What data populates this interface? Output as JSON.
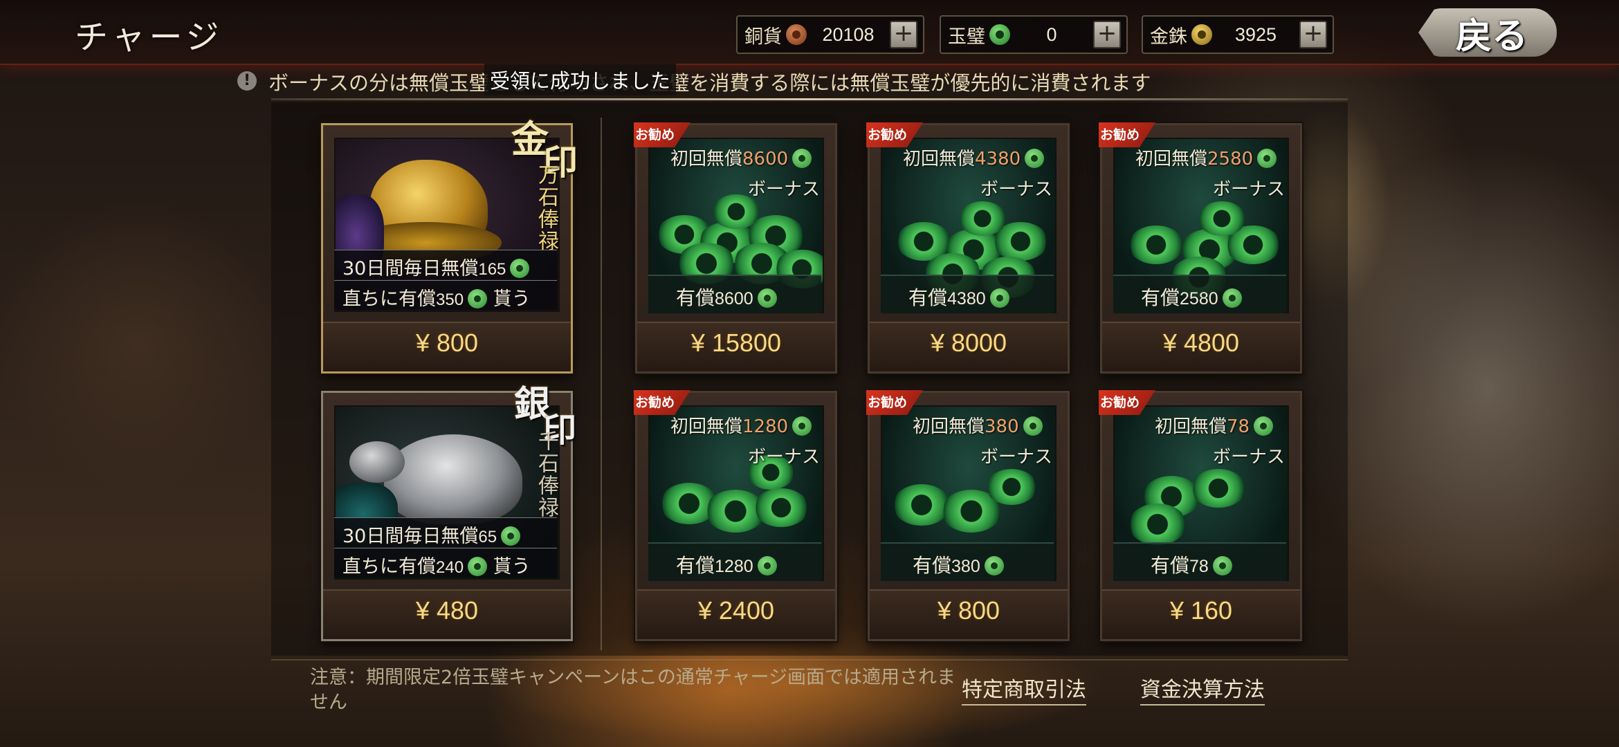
{
  "header": {
    "title": "チャージ",
    "currencies": [
      {
        "name": "銅貨",
        "icon": "copper-coin-icon",
        "value": "20108",
        "plus": "+"
      },
      {
        "name": "玉璧",
        "icon": "jade-coin-icon",
        "value": "0",
        "plus": "+"
      },
      {
        "name": "金銖",
        "icon": "gold-coin-icon",
        "value": "3925",
        "plus": "+"
      }
    ],
    "back_label": "戻る"
  },
  "notice": {
    "icon": "!",
    "text": "ボーナスの分は無償玉璧として付与され、玉璧を消費する際には無償玉璧が優先的に消費されます"
  },
  "toast": "受領に成功しました",
  "seals": [
    {
      "title_1": "金",
      "title_2": "印",
      "subtitle": "万石俸禄",
      "daily": {
        "prefix": "30日間毎日無償",
        "amount": "165"
      },
      "instant": {
        "prefix": "直ちに有償",
        "amount": "350",
        "suffix": "貰う"
      },
      "price": "¥ 800"
    },
    {
      "title_1": "銀",
      "title_2": "印",
      "subtitle": "千石俸禄",
      "daily": {
        "prefix": "30日間毎日無償",
        "amount": "65"
      },
      "instant": {
        "prefix": "直ちに有償",
        "amount": "240",
        "suffix": "貰う"
      },
      "price": "¥ 480"
    }
  ],
  "packs": [
    {
      "badge": "お勧め",
      "bonus_prefix": "初回無償",
      "bonus_amount": "8600",
      "bonus_word": "ボーナス",
      "paid_prefix": "有償",
      "paid_amount": "8600",
      "price": "¥ 15800"
    },
    {
      "badge": "お勧め",
      "bonus_prefix": "初回無償",
      "bonus_amount": "4380",
      "bonus_word": "ボーナス",
      "paid_prefix": "有償",
      "paid_amount": "4380",
      "price": "¥ 8000"
    },
    {
      "badge": "お勧め",
      "bonus_prefix": "初回無償",
      "bonus_amount": "2580",
      "bonus_word": "ボーナス",
      "paid_prefix": "有償",
      "paid_amount": "2580",
      "price": "¥ 4800"
    },
    {
      "badge": "お勧め",
      "bonus_prefix": "初回無償",
      "bonus_amount": "1280",
      "bonus_word": "ボーナス",
      "paid_prefix": "有償",
      "paid_amount": "1280",
      "price": "¥ 2400"
    },
    {
      "badge": "お勧め",
      "bonus_prefix": "初回無償",
      "bonus_amount": "380",
      "bonus_word": "ボーナス",
      "paid_prefix": "有償",
      "paid_amount": "380",
      "price": "¥ 800"
    },
    {
      "badge": "お勧め",
      "bonus_prefix": "初回無償",
      "bonus_amount": "78",
      "bonus_word": "ボーナス",
      "paid_prefix": "有償",
      "paid_amount": "78",
      "price": "¥ 160"
    }
  ],
  "footer": {
    "note": "注意：期間限定2倍玉璧キャンペーンはこの通常チャージ画面では適用されません",
    "link_commerce": "特定商取引法",
    "link_payment": "資金決算方法"
  }
}
